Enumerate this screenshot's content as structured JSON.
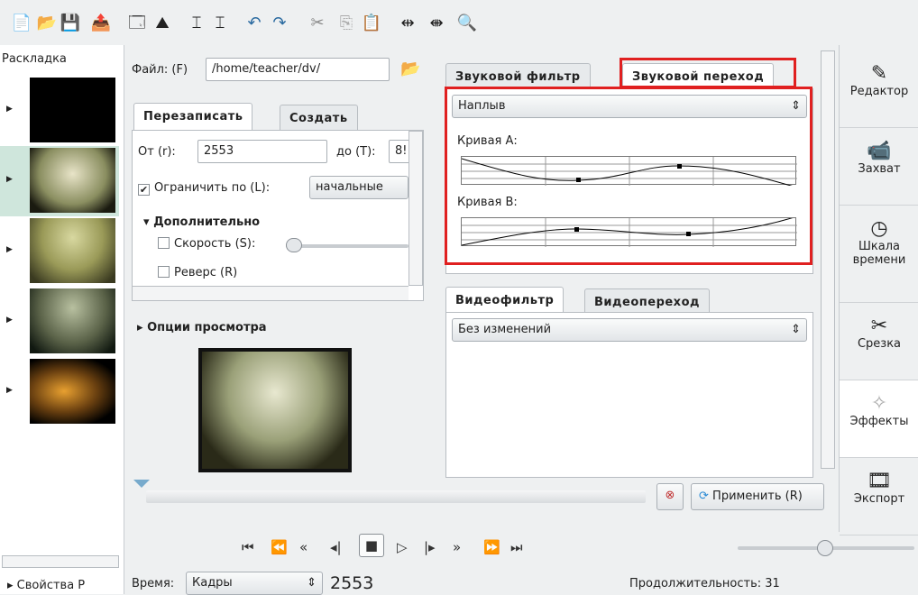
{
  "toolbar": {
    "icons": [
      "new-file-icon",
      "open-folder-icon",
      "save-icon",
      "export-icon",
      "save-as-icon",
      "import-icon",
      "cut-marker-icon",
      "cut-marker-right-icon",
      "undo-icon",
      "redo-icon",
      "scissors-icon",
      "copy-icon",
      "paste-icon",
      "expand-icon",
      "collapse-icon",
      "zoom-icon"
    ]
  },
  "sidebar": {
    "title": "Раскладка",
    "bottom_label": "Свойства Р"
  },
  "file": {
    "label": "Файл: (F)",
    "path": "/home/teacher/dv/"
  },
  "tabs_clip": {
    "overwrite": "Перезаписать",
    "create": "Создать"
  },
  "range": {
    "from_label": "От (r):",
    "from_value": "2553",
    "to_label": "до (T):",
    "to_value": "8!"
  },
  "limit": {
    "label": "Ограничить по (L):",
    "value": "начальные"
  },
  "advanced": {
    "label": "Дополнительно",
    "speed": "Скорость (S):",
    "reverse": "Реверс (R)"
  },
  "preview": {
    "label": "Опции просмотра"
  },
  "audio": {
    "tab_filter": "Звуковой фильтр",
    "tab_transition": "Звуковой переход",
    "selected": "Наплыв",
    "curve_a": "Кривая А:",
    "curve_b": "Кривая В:"
  },
  "video": {
    "tab_filter": "Видеофильтр",
    "tab_transition": "Видеопереход",
    "selected": "Без изменений"
  },
  "apply_button": "Применить (R)",
  "rightbar": {
    "items": [
      {
        "label": "Редактор",
        "icon": "editor-icon"
      },
      {
        "label": "Захват",
        "icon": "capture-icon"
      },
      {
        "label": "Шкала\nвремени",
        "icon": "timeline-icon"
      },
      {
        "label": "Срезка",
        "icon": "trim-icon"
      },
      {
        "label": "Эффекты",
        "icon": "effects-icon"
      },
      {
        "label": "Экспорт",
        "icon": "export-icon"
      }
    ]
  },
  "transport": {
    "buttons": [
      "⏮",
      "⏭",
      "⏪",
      "◀◀",
      "■",
      "▶",
      "▷|",
      "⏩",
      "|▶",
      "⏭"
    ]
  },
  "status": {
    "time_label": "Время:",
    "units": "Кадры",
    "frame": "2553",
    "duration": "Продолжительность: 31"
  },
  "colors": {
    "highlight": "#e02020",
    "accent": "#2a8ad4"
  }
}
